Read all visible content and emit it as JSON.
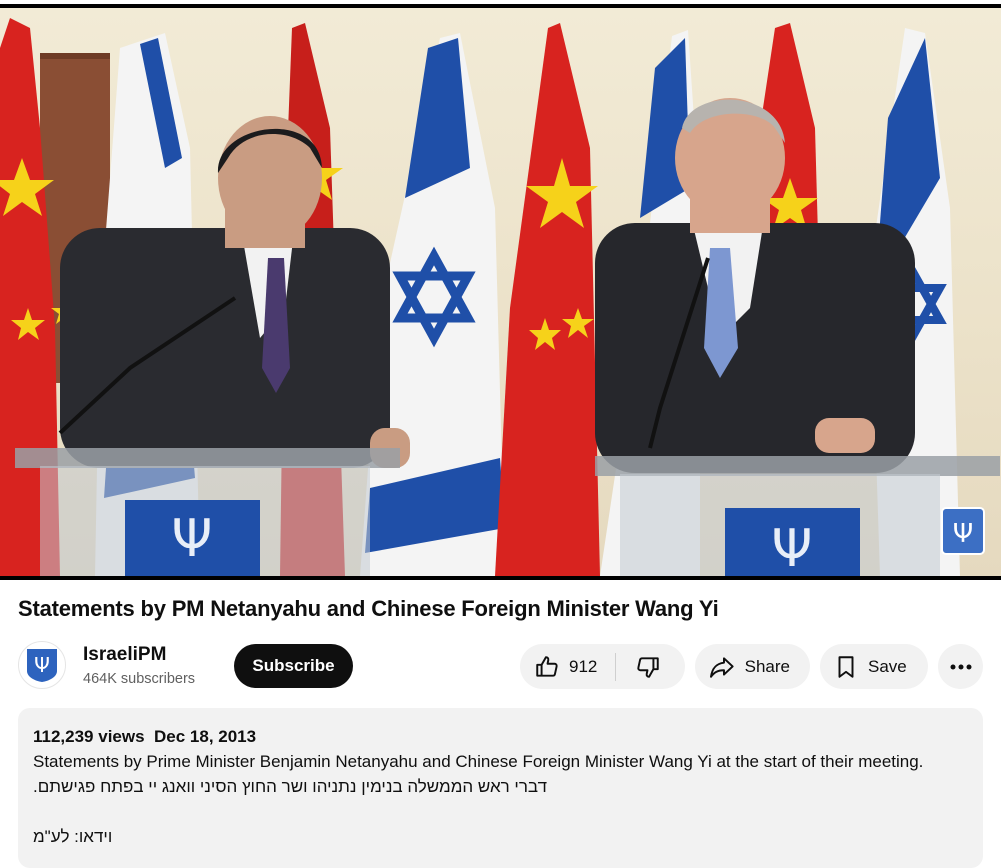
{
  "video": {
    "title": "Statements by PM Netanyahu and Chinese Foreign Minister Wang Yi"
  },
  "channel": {
    "name": "IsraeliPM",
    "subscribers": "464K subscribers",
    "subscribe_label": "Subscribe"
  },
  "actions": {
    "like_count": "912",
    "share_label": "Share",
    "save_label": "Save"
  },
  "description": {
    "views": "112,239 views",
    "date": "Dec 18, 2013",
    "line1": "Statements by Prime Minister Benjamin Netanyahu and Chinese Foreign Minister Wang Yi at the start of their meeting.",
    "line2": "דברי ראש הממשלה בנימין נתניהו ושר החוץ הסיני וואנג יי בפתח פגישתם.",
    "line3": "וידאו: לע\"מ"
  },
  "colors": {
    "israel_blue": "#1f4fa8",
    "china_red": "#d8231f",
    "china_yellow": "#f6d21a",
    "button_dark": "#0f0f0f",
    "chip_bg": "#f2f2f2"
  }
}
